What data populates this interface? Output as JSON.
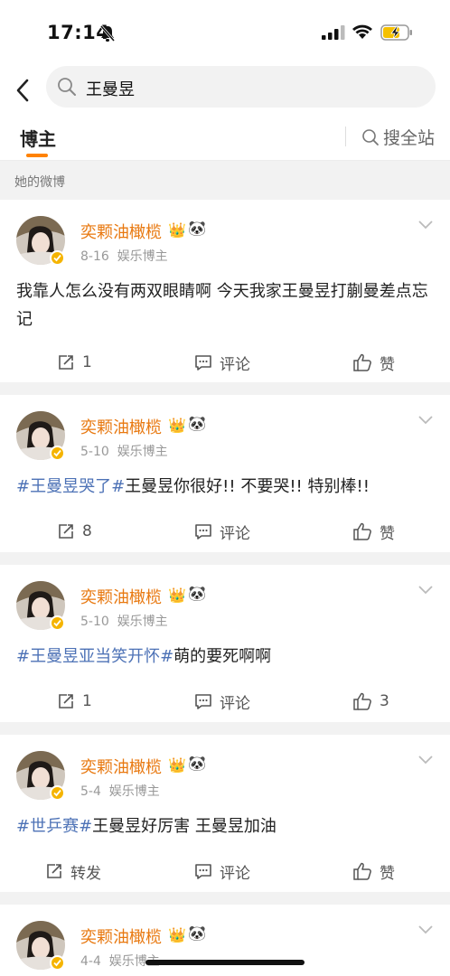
{
  "status": {
    "time": "17:14"
  },
  "search": {
    "query": "王曼昱"
  },
  "tabs": {
    "blogger": "博主",
    "search_all": "搜全站"
  },
  "section_label": "她的微博",
  "colors": {
    "accent": "#ff8200",
    "username": "#e8780f",
    "hashtag": "#4d72b6"
  },
  "posts": [
    {
      "username": "奕颗油橄榄",
      "date": "8-16",
      "source": "娱乐博主",
      "text_plain": "我靠人怎么没有两双眼睛啊 今天我家王曼昱打蒯曼差点忘记",
      "repost": "1",
      "comment": "评论",
      "like": "赞"
    },
    {
      "username": "奕颗油橄榄",
      "date": "5-10",
      "source": "娱乐博主",
      "hashtag": "#王曼昱哭了#",
      "text_plain": "王曼昱你很好!! 不要哭!! 特别棒!!",
      "repost": "8",
      "comment": "评论",
      "like": "赞"
    },
    {
      "username": "奕颗油橄榄",
      "date": "5-10",
      "source": "娱乐博主",
      "hashtag": "#王曼昱亚当笑开怀#",
      "text_plain": "萌的要死啊啊",
      "repost": "1",
      "comment": "评论",
      "like": "3"
    },
    {
      "username": "奕颗油橄榄",
      "date": "5-4",
      "source": "娱乐博主",
      "hashtag": "#世乒赛#",
      "text_plain": "王曼昱好厉害 王曼昱加油",
      "repost": "转发",
      "comment": "评论",
      "like": "赞"
    },
    {
      "username": "奕颗油橄榄",
      "date": "4-4",
      "source": "娱乐博主"
    }
  ]
}
